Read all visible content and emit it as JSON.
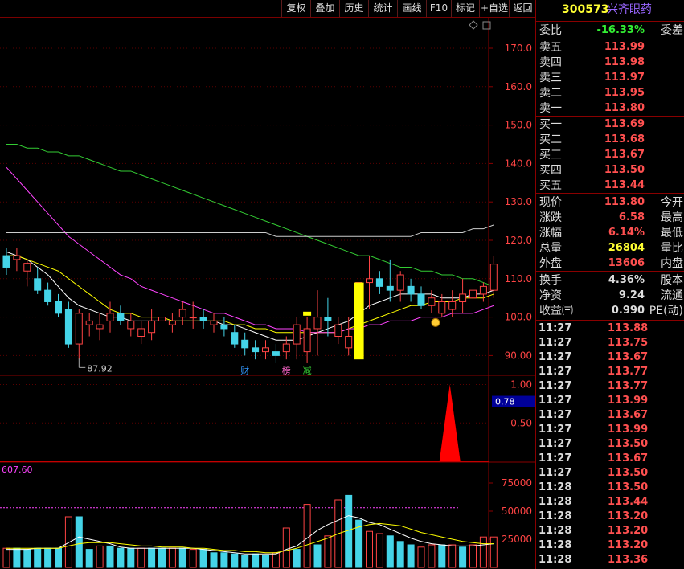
{
  "toolbar": {
    "buttons": [
      "复权",
      "叠加",
      "历史",
      "统计",
      "画线",
      "F10",
      "标记",
      "+自选",
      "返回"
    ]
  },
  "stock": {
    "code": "300573",
    "name": "兴齐眼药"
  },
  "colors": {
    "up": "#ff4444",
    "down": "#44d4e8",
    "ma5": "#ffffff",
    "ma10": "#ffff00",
    "ma20": "#ff44ff",
    "ma60": "#33cc33",
    "ma120": "#cccccc"
  },
  "panel": {
    "weibi": {
      "label": "委比",
      "value": "-16.33%",
      "label2": "委差"
    },
    "sells": [
      {
        "label": "卖五",
        "price": "113.99"
      },
      {
        "label": "卖四",
        "price": "113.98"
      },
      {
        "label": "卖三",
        "price": "113.97"
      },
      {
        "label": "卖二",
        "price": "113.95"
      },
      {
        "label": "卖一",
        "price": "113.80"
      }
    ],
    "buys": [
      {
        "label": "买一",
        "price": "113.69"
      },
      {
        "label": "买二",
        "price": "113.68"
      },
      {
        "label": "买三",
        "price": "113.67"
      },
      {
        "label": "买四",
        "price": "113.50"
      },
      {
        "label": "买五",
        "price": "113.44"
      }
    ],
    "quote": [
      {
        "label": "现价",
        "value": "113.80",
        "label2": "今开",
        "cls": "red"
      },
      {
        "label": "涨跌",
        "value": "6.58",
        "label2": "最高",
        "cls": "red"
      },
      {
        "label": "涨幅",
        "value": "6.14%",
        "label2": "最低",
        "cls": "red"
      },
      {
        "label": "总量",
        "value": "26804",
        "label2": "量比",
        "cls": "yel"
      },
      {
        "label": "外盘",
        "value": "13606",
        "label2": "内盘",
        "cls": "red"
      }
    ],
    "fund": [
      {
        "label": "换手",
        "value": "4.36%",
        "label2": "股本",
        "cls": "wht"
      },
      {
        "label": "净资",
        "value": "9.24",
        "label2": "流通",
        "cls": "wht"
      },
      {
        "label": "收益㈢",
        "value": "0.990",
        "label2": "PE(动)",
        "cls": "wht"
      }
    ],
    "ticks": [
      {
        "time": "11:27",
        "price": "113.88"
      },
      {
        "time": "11:27",
        "price": "113.75"
      },
      {
        "time": "11:27",
        "price": "113.67"
      },
      {
        "time": "11:27",
        "price": "113.77"
      },
      {
        "time": "11:27",
        "price": "113.77"
      },
      {
        "time": "11:27",
        "price": "113.99"
      },
      {
        "time": "11:27",
        "price": "113.67"
      },
      {
        "time": "11:27",
        "price": "113.99"
      },
      {
        "time": "11:27",
        "price": "113.50"
      },
      {
        "time": "11:27",
        "price": "113.67"
      },
      {
        "time": "11:27",
        "price": "113.50"
      },
      {
        "time": "11:28",
        "price": "113.50"
      },
      {
        "time": "11:28",
        "price": "113.44"
      },
      {
        "time": "11:28",
        "price": "113.20"
      },
      {
        "time": "11:28",
        "price": "113.20"
      },
      {
        "time": "11:28",
        "price": "113.20"
      },
      {
        "time": "11:28",
        "price": "113.36"
      }
    ]
  },
  "chart_data": [
    {
      "type": "candlestick",
      "y_ticks": [
        "170.0",
        "160.0",
        "150.0",
        "140.0",
        "130.0",
        "120.0",
        "110.0",
        "100.0",
        "90.00"
      ],
      "ylim": [
        87,
        176
      ],
      "low_marker": "87.92",
      "markers": [
        {
          "label": "财",
          "candle": 23
        },
        {
          "label": "榜",
          "candle": 27
        },
        {
          "label": "减",
          "candle": 29
        }
      ],
      "ohlc": [
        [
          116,
          118,
          111,
          113
        ],
        [
          115,
          118,
          112,
          116
        ],
        [
          112,
          115,
          108,
          114
        ],
        [
          110,
          113,
          106,
          107
        ],
        [
          107,
          109,
          103,
          104
        ],
        [
          104,
          106,
          100,
          101
        ],
        [
          102,
          104,
          92,
          93
        ],
        [
          93,
          102,
          89,
          101
        ],
        [
          98,
          101,
          95,
          99
        ],
        [
          97,
          101,
          94,
          98
        ],
        [
          99,
          104,
          96,
          101
        ],
        [
          101,
          103,
          98,
          99
        ],
        [
          97,
          101,
          95,
          99
        ],
        [
          95,
          99,
          93,
          97
        ],
        [
          96,
          102,
          94,
          99
        ],
        [
          99,
          102,
          96,
          100
        ],
        [
          98,
          101,
          96,
          99
        ],
        [
          100,
          104,
          98,
          102
        ],
        [
          100,
          104,
          97,
          100
        ],
        [
          100,
          102,
          97,
          99
        ],
        [
          98,
          101,
          96,
          99
        ],
        [
          98,
          100,
          95,
          97
        ],
        [
          96,
          98,
          92,
          93
        ],
        [
          94,
          96,
          90,
          92
        ],
        [
          92,
          94,
          89,
          91
        ],
        [
          91,
          94,
          89,
          92
        ],
        [
          91,
          93,
          88,
          90
        ],
        [
          91,
          95,
          89,
          93
        ],
        [
          93,
          100,
          89,
          98
        ],
        [
          91,
          100,
          88,
          97
        ],
        [
          97,
          107,
          90,
          100
        ],
        [
          100,
          105,
          95,
          99
        ],
        [
          95,
          100,
          93,
          98
        ],
        [
          92,
          100,
          90,
          95
        ],
        [
          94,
          109,
          90,
          109
        ],
        [
          109,
          116,
          102,
          110
        ],
        [
          110,
          112,
          106,
          108
        ],
        [
          108,
          115,
          104,
          107
        ],
        [
          107,
          112,
          104,
          111
        ],
        [
          108,
          110,
          104,
          106
        ],
        [
          106,
          108,
          102,
          103
        ],
        [
          103,
          107,
          101,
          105
        ],
        [
          101,
          106,
          100,
          104
        ],
        [
          102,
          107,
          100,
          104
        ],
        [
          104,
          110,
          101,
          106
        ],
        [
          105,
          109,
          102,
          107
        ],
        [
          106,
          109,
          104,
          108
        ],
        [
          107,
          116,
          105,
          113.8
        ]
      ],
      "ma_series": [
        {
          "values": [
            117,
            116,
            115,
            113,
            111,
            108,
            105,
            103,
            102,
            101,
            100,
            100,
            99,
            99,
            99,
            99,
            99,
            99,
            99,
            99,
            99,
            98,
            98,
            97,
            96,
            95,
            94,
            94,
            94,
            95,
            96,
            97,
            98,
            99,
            101,
            103,
            104,
            105,
            106,
            106,
            106,
            106,
            105,
            105,
            105,
            106,
            106,
            107
          ]
        },
        {
          "values": [
            116,
            116,
            115,
            114,
            113,
            112,
            110,
            108,
            106,
            104,
            102,
            101,
            101,
            100,
            100,
            100,
            99,
            99,
            99,
            99,
            99,
            99,
            98,
            98,
            97,
            97,
            96,
            96,
            96,
            96,
            96,
            96,
            96,
            97,
            98,
            99,
            100,
            101,
            102,
            103,
            103,
            104,
            104,
            104,
            105,
            105,
            105,
            106
          ]
        },
        {
          "values": [
            139,
            136,
            133,
            130,
            127,
            124,
            121,
            119,
            117,
            115,
            113,
            111,
            110,
            108,
            107,
            106,
            105,
            104,
            103,
            102,
            101,
            101,
            100,
            99,
            98,
            98,
            97,
            97,
            97,
            96,
            96,
            96,
            96,
            97,
            97,
            98,
            98,
            99,
            99,
            99,
            100,
            100,
            100,
            101,
            101,
            101,
            102,
            103
          ]
        },
        {
          "values": [
            145,
            145,
            144,
            144,
            143,
            143,
            142,
            142,
            141,
            140,
            139,
            138,
            138,
            137,
            136,
            135,
            134,
            133,
            132,
            131,
            130,
            129,
            128,
            127,
            126,
            125,
            124,
            123,
            122,
            121,
            120,
            119,
            118,
            117,
            116,
            116,
            115,
            114,
            113,
            113,
            112,
            112,
            111,
            111,
            110,
            110,
            109,
            108
          ]
        },
        {
          "values": [
            122,
            122,
            122,
            122,
            122,
            122,
            122,
            122,
            122,
            122,
            122,
            122,
            122,
            122,
            122,
            122,
            122,
            122,
            122,
            122,
            122,
            122,
            122,
            122,
            122,
            122,
            121,
            121,
            121,
            121,
            121,
            121,
            121,
            121,
            121,
            121,
            121,
            121,
            121,
            121,
            122,
            122,
            122,
            122,
            122,
            123,
            123,
            124
          ]
        }
      ]
    },
    {
      "type": "indicator",
      "y_ticks": [
        "1.00",
        "0.50"
      ],
      "ylim": [
        0,
        1.1
      ],
      "current_label": "0.78",
      "spike_center_candle": 43,
      "spike_value": 1.0
    },
    {
      "type": "bar",
      "title": "607.60",
      "y_ticks": [
        "75000",
        "50000",
        "25000"
      ],
      "ylim": [
        0,
        90000
      ],
      "dashed_level": 53000,
      "values": [
        17000,
        17000,
        16000,
        17000,
        17000,
        17000,
        45000,
        45000,
        16000,
        19000,
        19000,
        17000,
        17000,
        17000,
        17000,
        17000,
        17000,
        17000,
        16000,
        16000,
        13000,
        13000,
        12000,
        11000,
        12000,
        11000,
        13000,
        35000,
        16000,
        56000,
        20000,
        28000,
        60000,
        64000,
        42000,
        32000,
        30000,
        28000,
        23000,
        20000,
        18000,
        20000,
        20000,
        20000,
        18000,
        20000,
        27000,
        27000
      ],
      "up_flags": [
        1,
        0,
        0,
        0,
        0,
        0,
        1,
        0,
        0,
        1,
        0,
        0,
        0,
        1,
        0,
        0,
        1,
        0,
        1,
        0,
        0,
        0,
        0,
        0,
        0,
        0,
        1,
        1,
        0,
        1,
        0,
        1,
        1,
        0,
        0,
        1,
        1,
        0,
        0,
        0,
        1,
        1,
        0,
        1,
        0,
        1,
        1,
        1
      ],
      "ma_series": [
        {
          "values": [
            16000,
            16000,
            16000,
            17000,
            17000,
            17000,
            22000,
            27000,
            25000,
            23000,
            21000,
            18000,
            17000,
            17000,
            17000,
            17000,
            17000,
            17000,
            17000,
            16000,
            15000,
            14000,
            13000,
            12000,
            12000,
            12000,
            12000,
            16000,
            19000,
            26000,
            33000,
            38000,
            42000,
            46000,
            44000,
            40000,
            38000,
            34000,
            30000,
            26000,
            23000,
            21000,
            20000,
            19000,
            19000,
            19000,
            20000,
            21000
          ]
        },
        {
          "values": [
            17000,
            17000,
            17000,
            17000,
            17000,
            17000,
            19000,
            21000,
            22000,
            22000,
            22000,
            21000,
            20000,
            19000,
            19000,
            18000,
            18000,
            18000,
            17000,
            17000,
            16000,
            15000,
            15000,
            14000,
            14000,
            13000,
            13000,
            15000,
            17000,
            20000,
            23000,
            26000,
            30000,
            33000,
            36000,
            38000,
            39000,
            38000,
            37000,
            34000,
            31000,
            29000,
            27000,
            25000,
            23000,
            22000,
            21000,
            21000
          ]
        }
      ]
    }
  ]
}
